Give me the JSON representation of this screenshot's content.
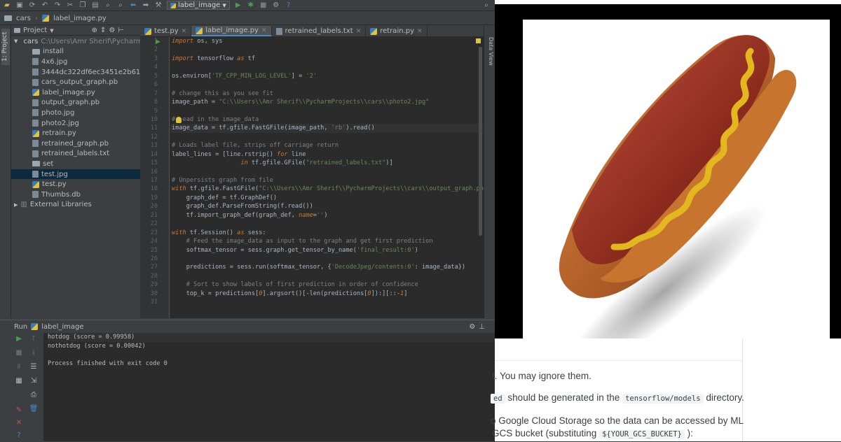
{
  "toolbar": {
    "run_config": "label_image"
  },
  "breadcrumb": {
    "project": "cars",
    "file": "label_image.py"
  },
  "sidebar": {
    "tab_label": "1: Project"
  },
  "project_panel": {
    "title": "Project",
    "root_name": "cars",
    "root_path": "C:\\Users\\Amr Sherif\\PycharmProj",
    "items": [
      {
        "name": "install",
        "type": "folder"
      },
      {
        "name": "4x6.jpg",
        "type": "file"
      },
      {
        "name": "3444dc322df6ec3451e2b61a.jpg.jpg",
        "type": "file"
      },
      {
        "name": "cars_output_graph.pb",
        "type": "file"
      },
      {
        "name": "label_image.py",
        "type": "py"
      },
      {
        "name": "output_graph.pb",
        "type": "file"
      },
      {
        "name": "photo.jpg",
        "type": "file"
      },
      {
        "name": "photo2.jpg",
        "type": "file"
      },
      {
        "name": "retrain.py",
        "type": "py"
      },
      {
        "name": "retrained_graph.pb",
        "type": "file"
      },
      {
        "name": "retrained_labels.txt",
        "type": "file"
      },
      {
        "name": "set",
        "type": "folder"
      },
      {
        "name": "test.jpg",
        "type": "file",
        "selected": true
      },
      {
        "name": "test.py",
        "type": "py"
      },
      {
        "name": "Thumbs.db",
        "type": "file"
      }
    ],
    "external": "External Libraries"
  },
  "editor": {
    "tabs": [
      "test.py",
      "label_image.py",
      "retrained_labels.txt",
      "retrain.py"
    ],
    "active_tab": 1,
    "code": [
      [
        {
          "t": "kw",
          "v": "import"
        },
        {
          "t": "n",
          "v": " os, sys"
        }
      ],
      [],
      [
        {
          "t": "kw",
          "v": "import"
        },
        {
          "t": "n",
          "v": " tensorflow "
        },
        {
          "t": "kw",
          "v": "as"
        },
        {
          "t": "n",
          "v": " tf"
        }
      ],
      [],
      [
        {
          "t": "n",
          "v": "os.environ["
        },
        {
          "t": "str",
          "v": "'TF_CPP_MIN_LOG_LEVEL'"
        },
        {
          "t": "n",
          "v": "] = "
        },
        {
          "t": "str",
          "v": "'2'"
        }
      ],
      [],
      [
        {
          "t": "cm",
          "v": "# change this as you see fit"
        }
      ],
      [
        {
          "t": "n",
          "v": "image_path = "
        },
        {
          "t": "str",
          "v": "\"C:\\\\Users\\\\Amr Sherif\\\\PycharmProjects\\\\cars\\\\photo2.jpg\""
        }
      ],
      [],
      [
        {
          "t": "cm",
          "v": "#  ead in the image_data"
        }
      ],
      [
        {
          "t": "n",
          "v": "image_data = tf.gfile.FastGFile(image_path, "
        },
        {
          "t": "str",
          "v": "'rb'"
        },
        {
          "t": "n",
          "v": ").read()"
        }
      ],
      [],
      [
        {
          "t": "cm",
          "v": "# Loads label file, strips off carriage return"
        }
      ],
      [
        {
          "t": "n",
          "v": "label_lines = [line.rstrip() "
        },
        {
          "t": "kw",
          "v": "for"
        },
        {
          "t": "n",
          "v": " line"
        }
      ],
      [
        {
          "t": "n",
          "v": "                   "
        },
        {
          "t": "kw",
          "v": "in"
        },
        {
          "t": "n",
          "v": " tf.gfile.GFile("
        },
        {
          "t": "str",
          "v": "\"retrained_labels.txt\""
        },
        {
          "t": "n",
          "v": ")]"
        }
      ],
      [],
      [
        {
          "t": "cm",
          "v": "# Unpersists graph from file"
        }
      ],
      [
        {
          "t": "kw",
          "v": "with"
        },
        {
          "t": "n",
          "v": " tf.gfile.FastGFile("
        },
        {
          "t": "str",
          "v": "\"C:\\\\Users\\\\Amr Sherif\\\\PycharmProjects\\\\cars\\\\output_graph.pb"
        }
      ],
      [
        {
          "t": "n",
          "v": "    graph_def = tf.GraphDef()"
        }
      ],
      [
        {
          "t": "n",
          "v": "    graph_def.ParseFromString(f.read())"
        }
      ],
      [
        {
          "t": "n",
          "v": "    tf.import_graph_def(graph_def, "
        },
        {
          "t": "kw",
          "v": "name"
        },
        {
          "t": "n",
          "v": "="
        },
        {
          "t": "str",
          "v": "''"
        },
        {
          "t": "n",
          "v": ")"
        }
      ],
      [],
      [
        {
          "t": "kw",
          "v": "with"
        },
        {
          "t": "n",
          "v": " tf.Session() "
        },
        {
          "t": "kw",
          "v": "as"
        },
        {
          "t": "n",
          "v": " sess:"
        }
      ],
      [
        {
          "t": "cm",
          "v": "    # Feed the image_data as input to the graph and get first prediction"
        }
      ],
      [
        {
          "t": "n",
          "v": "    softmax_tensor = sess.graph.get_tensor_by_name("
        },
        {
          "t": "str",
          "v": "'final_result:0'"
        },
        {
          "t": "n",
          "v": ")"
        }
      ],
      [],
      [
        {
          "t": "n",
          "v": "    predictions = sess.run(softmax_tensor, {"
        },
        {
          "t": "str",
          "v": "'DecodeJpeg/contents:0'"
        },
        {
          "t": "n",
          "v": ": image_data})"
        }
      ],
      [],
      [
        {
          "t": "cm",
          "v": "    # Sort to show labels of first prediction in order of confidence"
        }
      ],
      [
        {
          "t": "n",
          "v": "    top_k = predictions["
        },
        {
          "t": "kw",
          "v": "0"
        },
        {
          "t": "n",
          "v": "].argsort()[-len(predictions["
        },
        {
          "t": "kw",
          "v": "0"
        },
        {
          "t": "n",
          "v": "]):][::-"
        },
        {
          "t": "kw",
          "v": "1"
        },
        {
          "t": "n",
          "v": "]"
        }
      ],
      []
    ],
    "highlight_line": 11
  },
  "right_strip": {
    "tab_label": "Data View"
  },
  "run_panel": {
    "title": "Run",
    "config": "label_image",
    "output": [
      "hotdog (score = 0.99958)",
      "nothotdog (score = 0.00042)",
      "",
      "Process finished with exit code 0"
    ]
  },
  "docs": {
    "p1": "t. You may ignore them.",
    "p2_a": "ed",
    "p2_b": "should be generated in the",
    "p2_chip": "tensorflow/models",
    "p2_c": "directory.",
    "p3": "o Google Cloud Storage so the data can be accessed by ML",
    "p4_a": "GCS bucket (substituting",
    "p4_chip": "${YOUR_GCS_BUCKET}",
    "p4_b": "):"
  },
  "colors": {
    "ide_bg": "#3c3f41",
    "editor_bg": "#2b2b2b",
    "keyword": "#cc7832",
    "string": "#6a8759",
    "comment": "#808080",
    "run_green": "#499c54",
    "close_red": "#c75450"
  }
}
